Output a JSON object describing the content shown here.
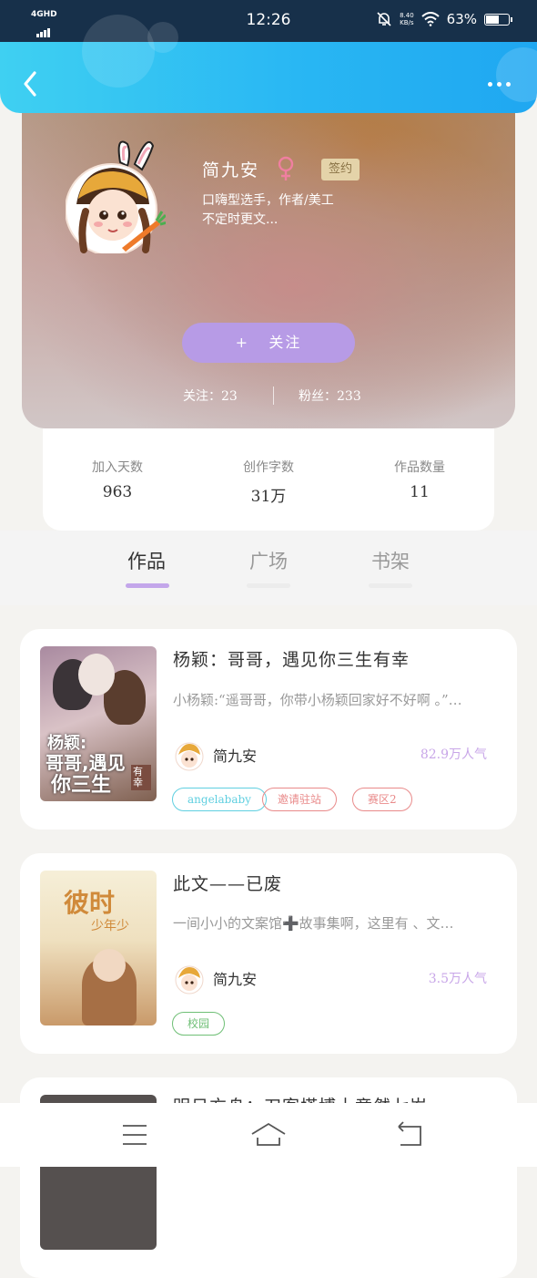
{
  "status_bar": {
    "network": "4GHD",
    "time": "12:26",
    "speed_value": "8.40",
    "speed_unit": "KB/s",
    "battery_text": "63%",
    "battery_level": 0.63
  },
  "header": {
    "back_icon": "chevron-left-icon",
    "more_icon": "more-dots-icon"
  },
  "profile": {
    "name": "简九安",
    "gender_icon": "female-icon",
    "badge": "签约",
    "bio": "口嗨型选手，作者/美工\n不定时更文...",
    "follow_label": "+   关注",
    "following_text": "关注：23",
    "followers_text": "粉丝：233"
  },
  "stats": [
    {
      "label": "加入天数",
      "value": "963"
    },
    {
      "label": "创作字数",
      "value": "31万"
    },
    {
      "label": "作品数量",
      "value": "11"
    }
  ],
  "tabs": [
    {
      "label": "作品",
      "active": true
    },
    {
      "label": "广场",
      "active": false
    },
    {
      "label": "书架",
      "active": false
    }
  ],
  "works": [
    {
      "title": "杨颖：哥哥，遇见你三生有幸",
      "desc": "小杨颖:“遥哥哥，你带小杨颖回家好不好啊 。”…",
      "author": "简九安",
      "popularity": "82.9万人气",
      "cover_text": [
        "杨颖:",
        "哥哥,遇见",
        "你三生",
        "有幸"
      ],
      "tags": [
        {
          "label": "angelababy",
          "color": "#5fcfe0"
        },
        {
          "label": "邀请驻站",
          "color": "#e98a8a"
        },
        {
          "label": "赛区2",
          "color": "#e98a8a"
        }
      ]
    },
    {
      "title": "此文——已废",
      "desc": "一间小小的文案馆➕故事集啊，这里有 、文…",
      "author": "简九安",
      "popularity": "3.5万人气",
      "cover_text": [
        "彼时",
        "少年少"
      ],
      "tags": [
        {
          "label": "校园",
          "color": "#6fbf76"
        }
      ]
    },
    {
      "title": "明日方舟：刀客塔博士竟然七岁"
    }
  ],
  "bottom_nav": {
    "menu_icon": "menu-icon",
    "home_icon": "home-icon",
    "back_icon": "back-arrow-icon"
  }
}
